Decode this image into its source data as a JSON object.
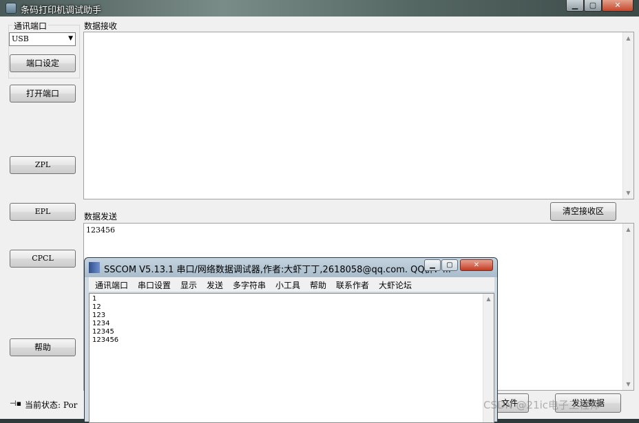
{
  "main_window": {
    "title": "条码打印机调试助手",
    "title_buttons": {
      "minimize": "▁",
      "maximize": "▢",
      "close": "✕"
    }
  },
  "left_panel": {
    "port_group_label": "通讯端口",
    "port_combo_value": "USB",
    "port_settings_button": "端口设定",
    "open_port_button": "打开端口",
    "zpl_button": "ZPL",
    "epl_button": "EPL",
    "cpcl_button": "CPCL",
    "help_button": "帮助"
  },
  "receive": {
    "label": "数据接收",
    "clear_button": "清空接收区"
  },
  "send": {
    "label": "数据发送",
    "text": "123456",
    "file_button": "文件",
    "send_button": "发送数据"
  },
  "status_bar": {
    "text": "当前状态: Por"
  },
  "sscom": {
    "title": "SSCOM V5.13.1 串口/网络数据调试器,作者:大虾丁丁,2618058@qq.com. QQ群：...",
    "menu": [
      "通讯端口",
      "串口设置",
      "显示",
      "发送",
      "多字符串",
      "小工具",
      "帮助",
      "联系作者",
      "大虾论坛"
    ],
    "lines": [
      "1",
      "12",
      "123",
      "1234",
      "12345",
      "123456"
    ]
  },
  "watermark": "CSDN @21ic电子工程师",
  "icons": {
    "app": "printer-icon",
    "combo_arrow": "chevron-down-icon",
    "status": "plug-icon",
    "sscom": "sscom-app-icon"
  },
  "colors": {
    "window_bg": "#f0f0f0",
    "close_button": "#c4462a",
    "sscom_frame": "#cfd9e2"
  }
}
